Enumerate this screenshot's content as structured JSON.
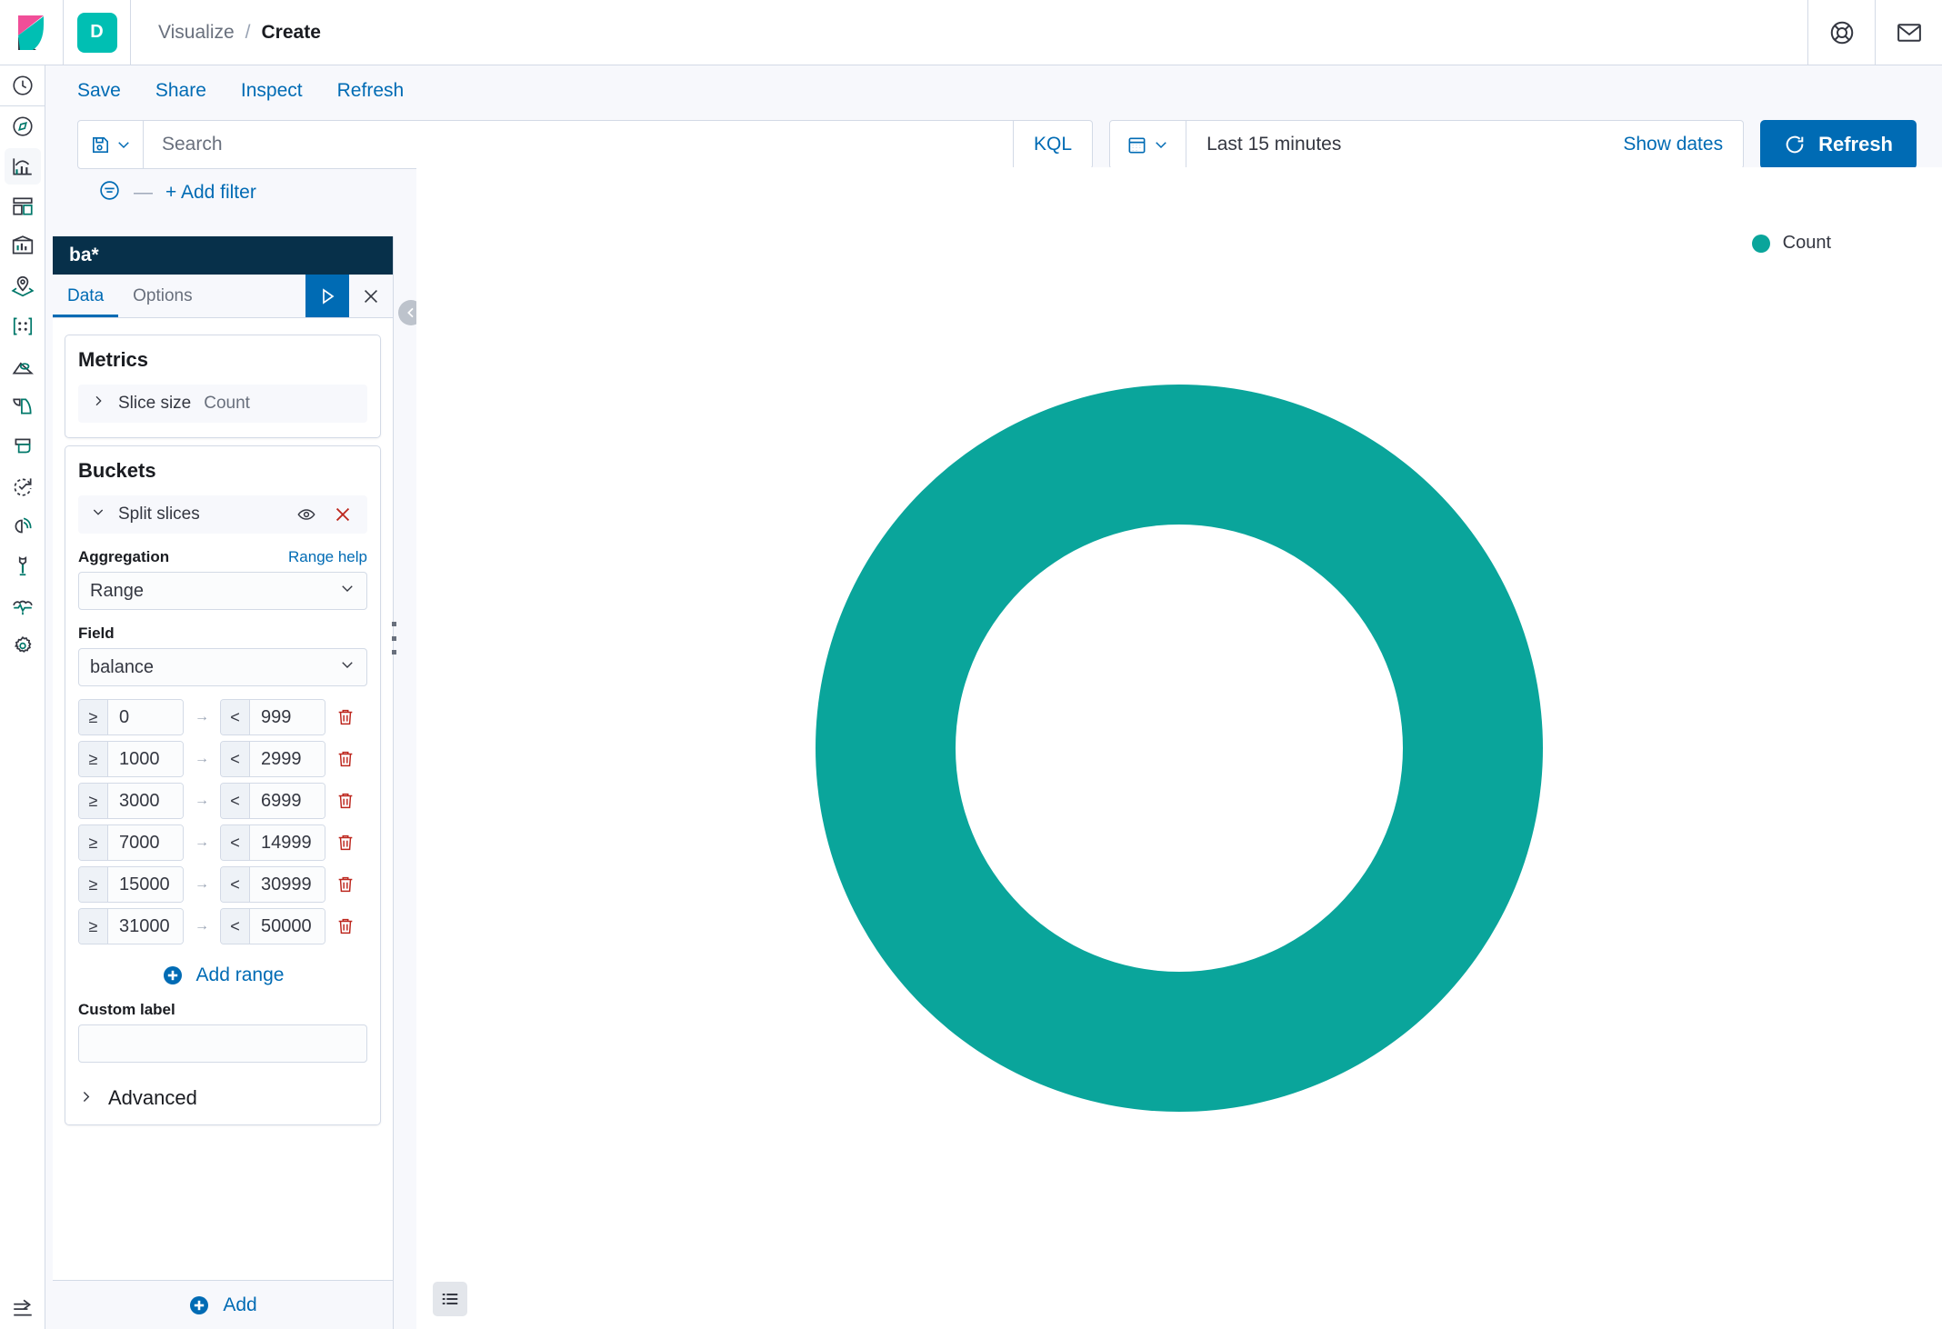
{
  "app": {
    "space_initial": "D",
    "breadcrumb": {
      "parent": "Visualize",
      "separator": "/",
      "current": "Create"
    },
    "header_icons": [
      "help-icon",
      "mail-icon"
    ]
  },
  "actions": {
    "save": "Save",
    "share": "Share",
    "inspect": "Inspect",
    "refresh": "Refresh"
  },
  "query": {
    "search_placeholder": "Search",
    "search_value": "",
    "language_badge": "KQL",
    "date_range": "Last 15 minutes",
    "show_dates": "Show dates",
    "refresh_button": "Refresh"
  },
  "filters": {
    "add_filter": "+ Add filter",
    "dash": "—"
  },
  "editor": {
    "index_pattern_title": "ba*",
    "tabs": [
      {
        "label": "Data",
        "active": true
      },
      {
        "label": "Options",
        "active": false
      }
    ],
    "apply_icon": "play-icon",
    "close_icon": "close-icon",
    "metrics": {
      "heading": "Metrics",
      "rows": [
        {
          "label": "Slice size",
          "value": "Count"
        }
      ]
    },
    "buckets": {
      "heading": "Buckets",
      "row_label": "Split slices",
      "aggregation_label": "Aggregation",
      "aggregation_help": "Range help",
      "aggregation_value": "Range",
      "field_label": "Field",
      "field_value": "balance",
      "ranges": [
        {
          "from_op": "≥",
          "from": "0",
          "arrow": "→",
          "to_op": "<",
          "to": "999"
        },
        {
          "from_op": "≥",
          "from": "1000",
          "arrow": "→",
          "to_op": "<",
          "to": "2999"
        },
        {
          "from_op": "≥",
          "from": "3000",
          "arrow": "→",
          "to_op": "<",
          "to": "6999"
        },
        {
          "from_op": "≥",
          "from": "7000",
          "arrow": "→",
          "to_op": "<",
          "to": "14999"
        },
        {
          "from_op": "≥",
          "from": "15000",
          "arrow": "→",
          "to_op": "<",
          "to": "30999"
        },
        {
          "from_op": "≥",
          "from": "31000",
          "arrow": "→",
          "to_op": "<",
          "to": "50000"
        }
      ],
      "add_range": "Add range",
      "custom_label_label": "Custom label",
      "custom_label_value": "",
      "advanced": "Advanced"
    },
    "footer_add": "Add"
  },
  "chart_data": {
    "type": "pie",
    "title": "",
    "donut": true,
    "legend": [
      {
        "label": "Count",
        "color": "#0AA59B"
      }
    ],
    "slices": [
      {
        "label": "Count",
        "value": 100,
        "percent": 100,
        "color": "#0AA59B"
      }
    ],
    "legend_position": "right",
    "inner_radius_ratio": 0.615
  },
  "colors": {
    "accent_blue": "#006BB4",
    "teal": "#0AA59B",
    "space_teal": "#00BFB3",
    "panel_dark": "#07304A",
    "danger_red": "#BD271E"
  }
}
